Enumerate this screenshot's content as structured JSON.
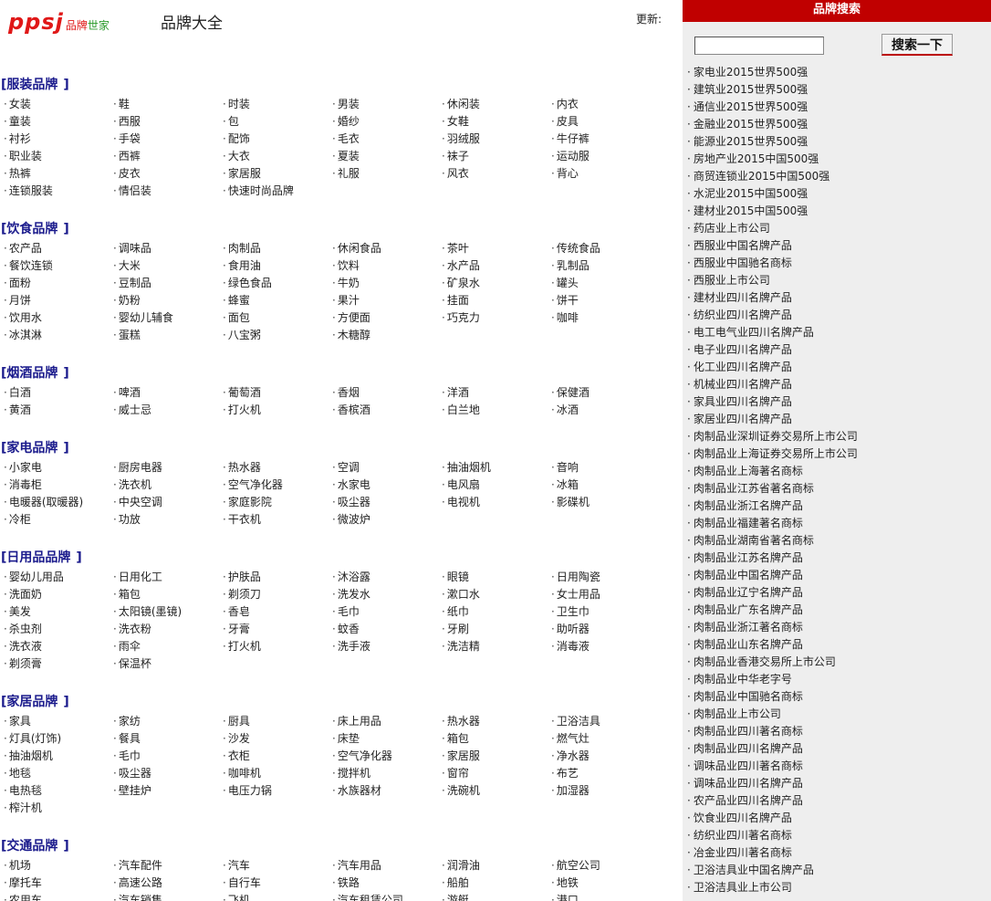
{
  "header": {
    "logo_text": "ppsj",
    "logo_sub_a": "品牌",
    "logo_sub_b": "世家",
    "title": "品牌大全",
    "update_label": "更新:"
  },
  "categories": [
    {
      "title": "服装品牌",
      "items": [
        "女装",
        "鞋",
        "时装",
        "男装",
        "休闲装",
        "内衣",
        "童装",
        "西服",
        "包",
        "婚纱",
        "女鞋",
        "皮具",
        "衬衫",
        "手袋",
        "配饰",
        "毛衣",
        "羽绒服",
        "牛仔裤",
        "职业装",
        "西裤",
        "大衣",
        "夏装",
        "袜子",
        "运动服",
        "热裤",
        "皮衣",
        "家居服",
        "礼服",
        "风衣",
        "背心",
        "连锁服装",
        "情侣装",
        "快速时尚品牌"
      ]
    },
    {
      "title": "饮食品牌",
      "items": [
        "农产品",
        "调味品",
        "肉制品",
        "休闲食品",
        "茶叶",
        "传统食品",
        "餐饮连锁",
        "大米",
        "食用油",
        "饮料",
        "水产品",
        "乳制品",
        "面粉",
        "豆制品",
        "绿色食品",
        "牛奶",
        "矿泉水",
        "罐头",
        "月饼",
        "奶粉",
        "蜂蜜",
        "果汁",
        "挂面",
        "饼干",
        "饮用水",
        "婴幼儿辅食",
        "面包",
        "方便面",
        "巧克力",
        "咖啡",
        "冰淇淋",
        "蛋糕",
        "八宝粥",
        "木糖醇"
      ]
    },
    {
      "title": "烟酒品牌",
      "items": [
        "白酒",
        "啤酒",
        "葡萄酒",
        "香烟",
        "洋酒",
        "保健酒",
        "黄酒",
        "威士忌",
        "打火机",
        "香槟酒",
        "白兰地",
        "冰酒"
      ]
    },
    {
      "title": "家电品牌",
      "items": [
        "小家电",
        "厨房电器",
        "热水器",
        "空调",
        "抽油烟机",
        "音响",
        "消毒柜",
        "洗衣机",
        "空气净化器",
        "水家电",
        "电风扇",
        "冰箱",
        "电暖器(取暖器)",
        "中央空调",
        "家庭影院",
        "吸尘器",
        "电视机",
        "影碟机",
        "冷柜",
        "功放",
        "干衣机",
        "微波炉"
      ]
    },
    {
      "title": "日用品品牌",
      "items": [
        "婴幼儿用品",
        "日用化工",
        "护肤品",
        "沐浴露",
        "眼镜",
        "日用陶瓷",
        "洗面奶",
        "箱包",
        "剃须刀",
        "洗发水",
        "漱口水",
        "女士用品",
        "美发",
        "太阳镜(墨镜)",
        "香皂",
        "毛巾",
        "纸巾",
        "卫生巾",
        "杀虫剂",
        "洗衣粉",
        "牙膏",
        "蚊香",
        "牙刷",
        "助听器",
        "洗衣液",
        "雨伞",
        "打火机",
        "洗手液",
        "洗洁精",
        "消毒液",
        "剃须膏",
        "保温杯"
      ]
    },
    {
      "title": "家居品牌",
      "items": [
        "家具",
        "家纺",
        "厨具",
        "床上用品",
        "热水器",
        "卫浴洁具",
        "灯具(灯饰)",
        "餐具",
        "沙发",
        "床垫",
        "箱包",
        "燃气灶",
        "抽油烟机",
        "毛巾",
        "衣柜",
        "空气净化器",
        "家居服",
        "净水器",
        "地毯",
        "吸尘器",
        "咖啡机",
        "搅拌机",
        "窗帘",
        "布艺",
        "电热毯",
        "壁挂炉",
        "电压力锅",
        "水族器材",
        "洗碗机",
        "加湿器",
        "榨汁机"
      ]
    },
    {
      "title": "交通品牌",
      "items": [
        "机场",
        "汽车配件",
        "汽车",
        "汽车用品",
        "润滑油",
        "航空公司",
        "摩托车",
        "高速公路",
        "自行车",
        "铁路",
        "船舶",
        "地铁",
        "农用车",
        "汽车销售",
        "飞机",
        "汽车租赁公司",
        "游艇",
        "港口"
      ]
    }
  ],
  "sidebar": {
    "header": "品牌搜索",
    "search_value": "",
    "search_button": "搜索一下",
    "items": [
      "家电业2015世界500强",
      "建筑业2015世界500强",
      "通信业2015世界500强",
      "金融业2015世界500强",
      "能源业2015世界500强",
      "房地产业2015中国500强",
      "商贸连锁业2015中国500强",
      "水泥业2015中国500强",
      "建材业2015中国500强",
      "药店业上市公司",
      "西服业中国名牌产品",
      "西服业中国驰名商标",
      "西服业上市公司",
      "建材业四川名牌产品",
      "纺织业四川名牌产品",
      "电工电气业四川名牌产品",
      "电子业四川名牌产品",
      "化工业四川名牌产品",
      "机械业四川名牌产品",
      "家具业四川名牌产品",
      "家居业四川名牌产品",
      "肉制品业深圳证券交易所上市公司",
      "肉制品业上海证券交易所上市公司",
      "肉制品业上海著名商标",
      "肉制品业江苏省著名商标",
      "肉制品业浙江名牌产品",
      "肉制品业福建著名商标",
      "肉制品业湖南省著名商标",
      "肉制品业江苏名牌产品",
      "肉制品业中国名牌产品",
      "肉制品业辽宁名牌产品",
      "肉制品业广东名牌产品",
      "肉制品业浙江著名商标",
      "肉制品业山东名牌产品",
      "肉制品业香港交易所上市公司",
      "肉制品业中华老字号",
      "肉制品业中国驰名商标",
      "肉制品业上市公司",
      "肉制品业四川著名商标",
      "肉制品业四川名牌产品",
      "调味品业四川著名商标",
      "调味品业四川名牌产品",
      "农产品业四川名牌产品",
      "饮食业四川名牌产品",
      "纺织业四川著名商标",
      "冶金业四川著名商标",
      "卫浴洁具业中国名牌产品",
      "卫浴洁具业上市公司"
    ]
  }
}
